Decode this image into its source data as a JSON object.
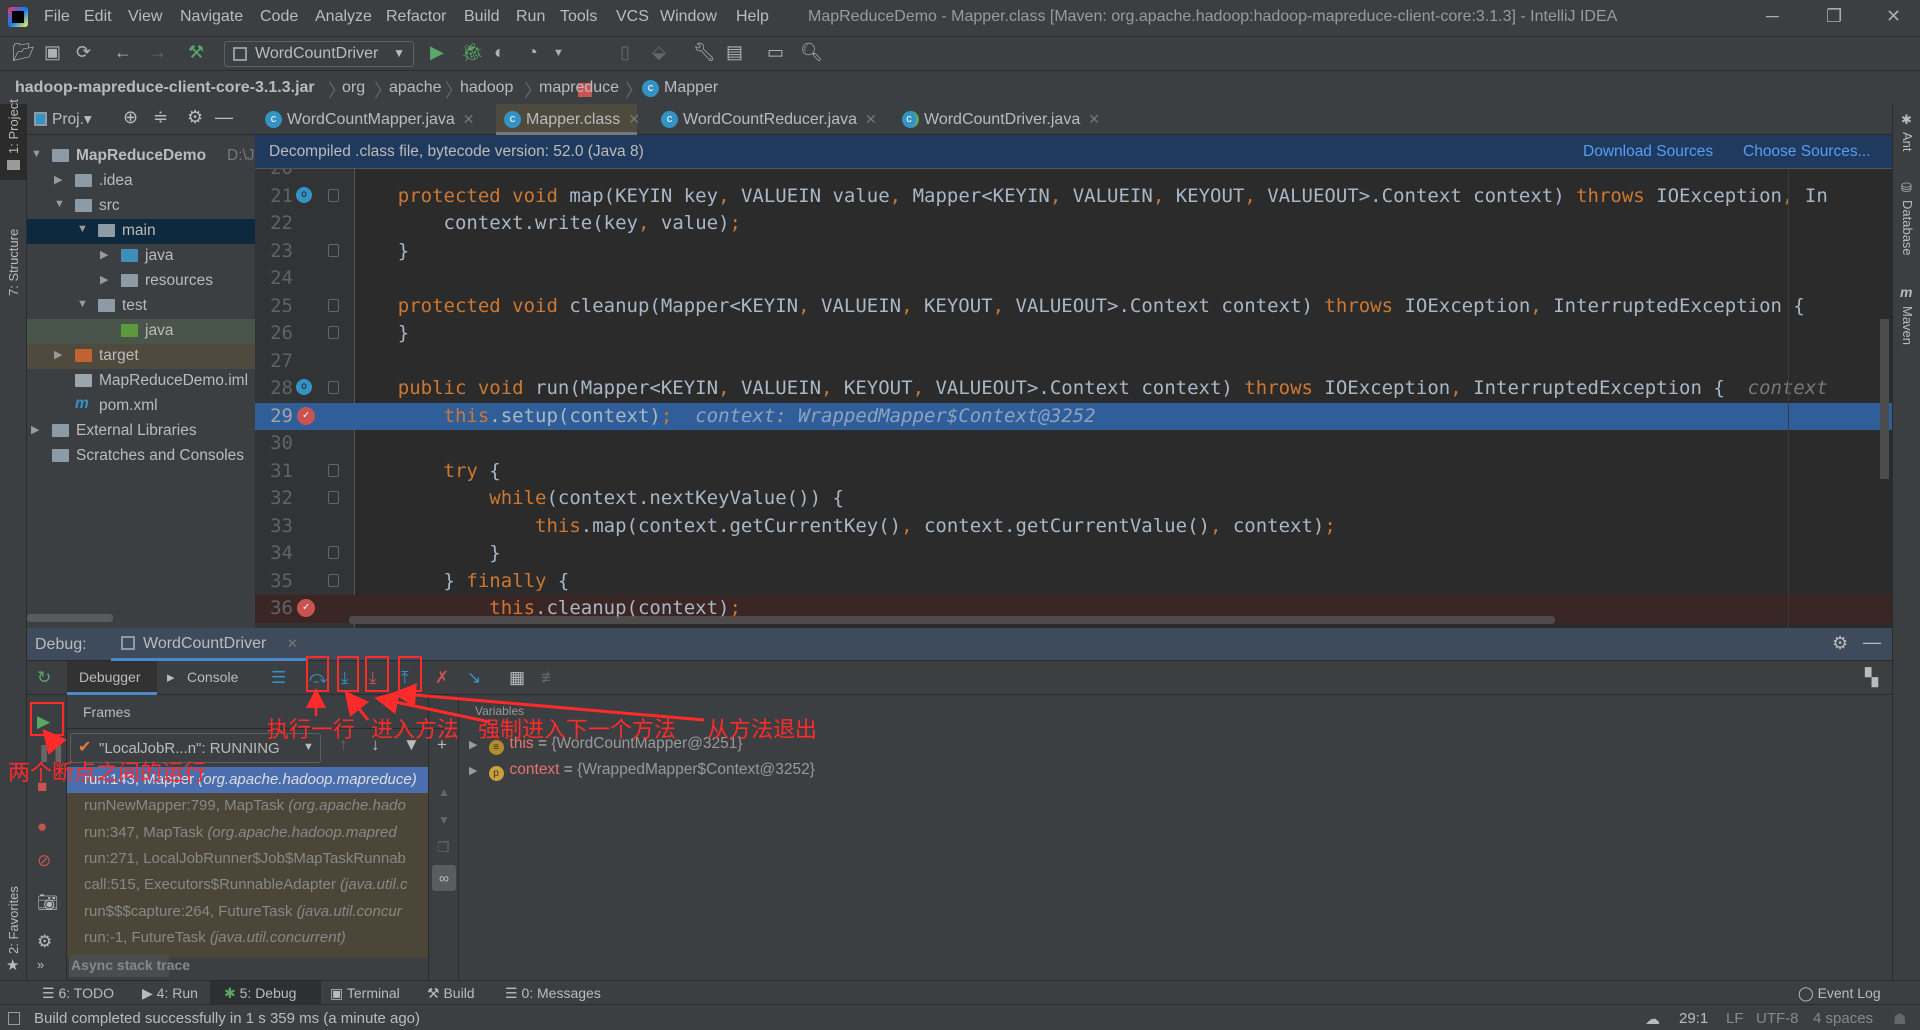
{
  "app": {
    "title": "MapReduceDemo - Mapper.class [Maven: org.apache.hadoop:hadoop-mapreduce-client-core:3.1.3] - IntelliJ IDEA",
    "menu": [
      "File",
      "Edit",
      "View",
      "Navigate",
      "Code",
      "Analyze",
      "Refactor",
      "Build",
      "Run",
      "Tools",
      "VCS",
      "Window",
      "Help"
    ],
    "window_controls": {
      "minimize": "─",
      "restore": "❐",
      "close": "✕"
    }
  },
  "toolbar": {
    "run_config": "WordCountDriver"
  },
  "breadcrumb": [
    "hadoop-mapreduce-client-core-3.1.3.jar",
    "org",
    "apache",
    "hadoop",
    "mapreduce",
    "Mapper"
  ],
  "left_strip": {
    "project": "1: Project",
    "structure": "7: Structure",
    "favorites": "2: Favorites"
  },
  "right_strip": {
    "ant": "Ant",
    "database": "Database",
    "maven": "Maven"
  },
  "project": {
    "header": "Proj.▾",
    "tree": [
      {
        "label": "MapReduceDemo",
        "suffix": "D:\\JA",
        "depth": 0,
        "arrow": "▼",
        "icon": "module-folder-icon",
        "color": "#8c9ba5",
        "bold": true
      },
      {
        "label": ".idea",
        "depth": 1,
        "arrow": "▶",
        "icon": "folder-icon",
        "color": "#8c9ba5"
      },
      {
        "label": "src",
        "depth": 1,
        "arrow": "▼",
        "icon": "folder-icon",
        "color": "#8c9ba5"
      },
      {
        "label": "main",
        "depth": 2,
        "arrow": "▼",
        "icon": "folder-icon",
        "color": "#8c9ba5",
        "bg": "#0d293e"
      },
      {
        "label": "java",
        "depth": 3,
        "arrow": "▶",
        "icon": "source-folder-icon",
        "color": "#3d8fb8"
      },
      {
        "label": "resources",
        "depth": 3,
        "arrow": "▶",
        "icon": "resources-folder-icon",
        "color": "#8c9ba5"
      },
      {
        "label": "test",
        "depth": 2,
        "arrow": "▼",
        "icon": "folder-icon",
        "color": "#8c9ba5"
      },
      {
        "label": "java",
        "depth": 3,
        "arrow": "",
        "icon": "test-folder-icon",
        "color": "#5a9a3c",
        "bg": "#49544a"
      },
      {
        "label": "target",
        "depth": 1,
        "arrow": "▶",
        "icon": "excluded-folder-icon",
        "color": "#c26230",
        "bg": "#4f4a3d"
      },
      {
        "label": "MapReduceDemo.iml",
        "depth": 1,
        "arrow": "",
        "icon": "iml-file-icon",
        "color": "#9aa5ac"
      },
      {
        "label": "pom.xml",
        "depth": 1,
        "arrow": "",
        "icon": "maven-icon",
        "color": "#3592c4"
      },
      {
        "label": "External Libraries",
        "depth": 0,
        "arrow": "▶",
        "icon": "libraries-icon",
        "color": "#8c9ba5"
      },
      {
        "label": "Scratches and Consoles",
        "depth": 0,
        "arrow": "",
        "icon": "scratches-icon",
        "color": "#8c9ba5"
      }
    ]
  },
  "tabs": [
    {
      "label": "WordCountMapper.java",
      "active": false
    },
    {
      "label": "Mapper.class",
      "active": true
    },
    {
      "label": "WordCountReducer.java",
      "active": false
    },
    {
      "label": "WordCountDriver.java",
      "active": false
    }
  ],
  "banner": {
    "message": "Decompiled .class file, bytecode version: 52.0 (Java 8)",
    "download": "Download Sources",
    "choose": "Choose Sources..."
  },
  "editor": {
    "current_line": 29,
    "lines": [
      {
        "n": "20",
        "t": []
      },
      {
        "n": "21",
        "mark": "override",
        "fold": true,
        "t": [
          [
            "    protected void ",
            "k"
          ],
          [
            "map(KEYIN key",
            ""
          ],
          [
            ", ",
            "k"
          ],
          [
            "VALUEIN value",
            ""
          ],
          [
            ", ",
            "k"
          ],
          [
            "Mapper<KEYIN",
            ""
          ],
          [
            ", ",
            "k"
          ],
          [
            "VALUEIN",
            ""
          ],
          [
            ", ",
            "k"
          ],
          [
            "KEYOUT",
            ""
          ],
          [
            ", ",
            "k"
          ],
          [
            "VALUEOUT>.Context context) ",
            ""
          ],
          [
            "throws ",
            "k"
          ],
          [
            "IOException",
            ""
          ],
          [
            ", ",
            "k"
          ],
          [
            "In",
            ""
          ]
        ]
      },
      {
        "n": "22",
        "t": [
          [
            "        context.write(key",
            ""
          ],
          [
            ", ",
            "k"
          ],
          [
            "value)",
            ""
          ],
          [
            ";",
            "k"
          ]
        ]
      },
      {
        "n": "23",
        "fold": true,
        "t": [
          [
            "    }",
            ""
          ]
        ]
      },
      {
        "n": "24",
        "t": []
      },
      {
        "n": "25",
        "fold": true,
        "t": [
          [
            "    protected void ",
            "k"
          ],
          [
            "cleanup(Mapper<KEYIN",
            ""
          ],
          [
            ", ",
            "k"
          ],
          [
            "VALUEIN",
            ""
          ],
          [
            ", ",
            "k"
          ],
          [
            "KEYOUT",
            ""
          ],
          [
            ", ",
            "k"
          ],
          [
            "VALUEOUT>.Context context) ",
            ""
          ],
          [
            "throws ",
            "k"
          ],
          [
            "IOException",
            ""
          ],
          [
            ", ",
            "k"
          ],
          [
            "InterruptedException {",
            ""
          ]
        ]
      },
      {
        "n": "26",
        "fold": true,
        "t": [
          [
            "    }",
            ""
          ]
        ]
      },
      {
        "n": "27",
        "t": []
      },
      {
        "n": "28",
        "mark": "override",
        "fold": true,
        "t": [
          [
            "    public void ",
            "k"
          ],
          [
            "run(Mapper<KEYIN",
            ""
          ],
          [
            ", ",
            "k"
          ],
          [
            "VALUEIN",
            ""
          ],
          [
            ", ",
            "k"
          ],
          [
            "KEYOUT",
            ""
          ],
          [
            ", ",
            "k"
          ],
          [
            "VALUEOUT>.Context context) ",
            ""
          ],
          [
            "throws ",
            "k"
          ],
          [
            "IOException",
            ""
          ],
          [
            ", ",
            "k"
          ],
          [
            "InterruptedException {  ",
            ""
          ],
          [
            "context",
            "h"
          ]
        ]
      },
      {
        "n": "29",
        "mark": "breakpoint",
        "cur": true,
        "t": [
          [
            "        this",
            "k"
          ],
          [
            ".setup(context)",
            ""
          ],
          [
            ";",
            "k"
          ],
          [
            "  context: WrappedMapper$Context@3252",
            "h"
          ]
        ]
      },
      {
        "n": "30",
        "t": []
      },
      {
        "n": "31",
        "fold": true,
        "t": [
          [
            "        try ",
            "k"
          ],
          [
            "{",
            ""
          ]
        ]
      },
      {
        "n": "32",
        "fold": true,
        "t": [
          [
            "            while",
            "k"
          ],
          [
            "(context.nextKeyValue()) {",
            ""
          ]
        ]
      },
      {
        "n": "33",
        "t": [
          [
            "                this",
            "k"
          ],
          [
            ".map(context.getCurrentKey()",
            ""
          ],
          [
            ", ",
            "k"
          ],
          [
            "context.getCurrentValue()",
            ""
          ],
          [
            ", ",
            "k"
          ],
          [
            "context)",
            ""
          ],
          [
            ";",
            "k"
          ]
        ]
      },
      {
        "n": "34",
        "fold": true,
        "t": [
          [
            "            }",
            ""
          ]
        ]
      },
      {
        "n": "35",
        "fold": true,
        "t": [
          [
            "        } ",
            ""
          ],
          [
            "finally ",
            "k"
          ],
          [
            "{",
            ""
          ]
        ]
      },
      {
        "n": "36",
        "mark": "breakpoint",
        "bp": true,
        "t": [
          [
            "            this",
            "k"
          ],
          [
            ".cleanup(context)",
            ""
          ],
          [
            ";",
            "k"
          ]
        ]
      }
    ]
  },
  "debug": {
    "label": "Debug:",
    "session": "WordCountDriver",
    "tabs": {
      "debugger": "Debugger",
      "console": "Console"
    },
    "frames_header": "Frames",
    "variables_header": "Variables",
    "thread": "\"LocalJobR...n\": RUNNING",
    "frames": [
      {
        "m": "run:143, Mapper ",
        "p": "(org.apache.hadoop.mapreduce)",
        "sel": true
      },
      {
        "m": "runNewMapper:799, MapTask ",
        "p": "(org.apache.hado"
      },
      {
        "m": "run:347, MapTask ",
        "p": "(org.apache.hadoop.mapred"
      },
      {
        "m": "run:271, LocalJobRunner$Job$MapTaskRunnab",
        "p": ""
      },
      {
        "m": "call:515, Executors$RunnableAdapter ",
        "p": "(java.util.c"
      },
      {
        "m": "run$$$capture:264, FutureTask ",
        "p": "(java.util.concur"
      },
      {
        "m": "run:-1, FutureTask ",
        "p": "(java.util.concurrent)"
      }
    ],
    "async": "Async stack trace",
    "variables": [
      {
        "name": "this",
        "value": "{WordCountMapper@3251}",
        "icon": "field-icon"
      },
      {
        "name": "context",
        "value": "{WrappedMapper$Context@3252}",
        "icon": "parameter-icon"
      }
    ]
  },
  "annotations": {
    "step_over": "执行一行",
    "step_into": "进入方法",
    "force_step_into": "强制进入下一个方法",
    "step_out": "从方法退出",
    "resume": "两个断点之间的运行"
  },
  "bottom_tabs": [
    "6: TODO",
    "4: Run",
    "5: Debug",
    "Terminal",
    "Build",
    "0: Messages"
  ],
  "event_log": "Event Log",
  "status": {
    "message": "Build completed successfully in 1 s 359 ms (a minute ago)",
    "position": "29:1",
    "line_sep": "LF",
    "encoding": "UTF-8",
    "indent": "4 spaces"
  },
  "colors": {
    "accent": "#2f5e99",
    "keyword": "#cc7832",
    "breakpoint": "#c75450",
    "annotation": "#ff2a2a"
  }
}
